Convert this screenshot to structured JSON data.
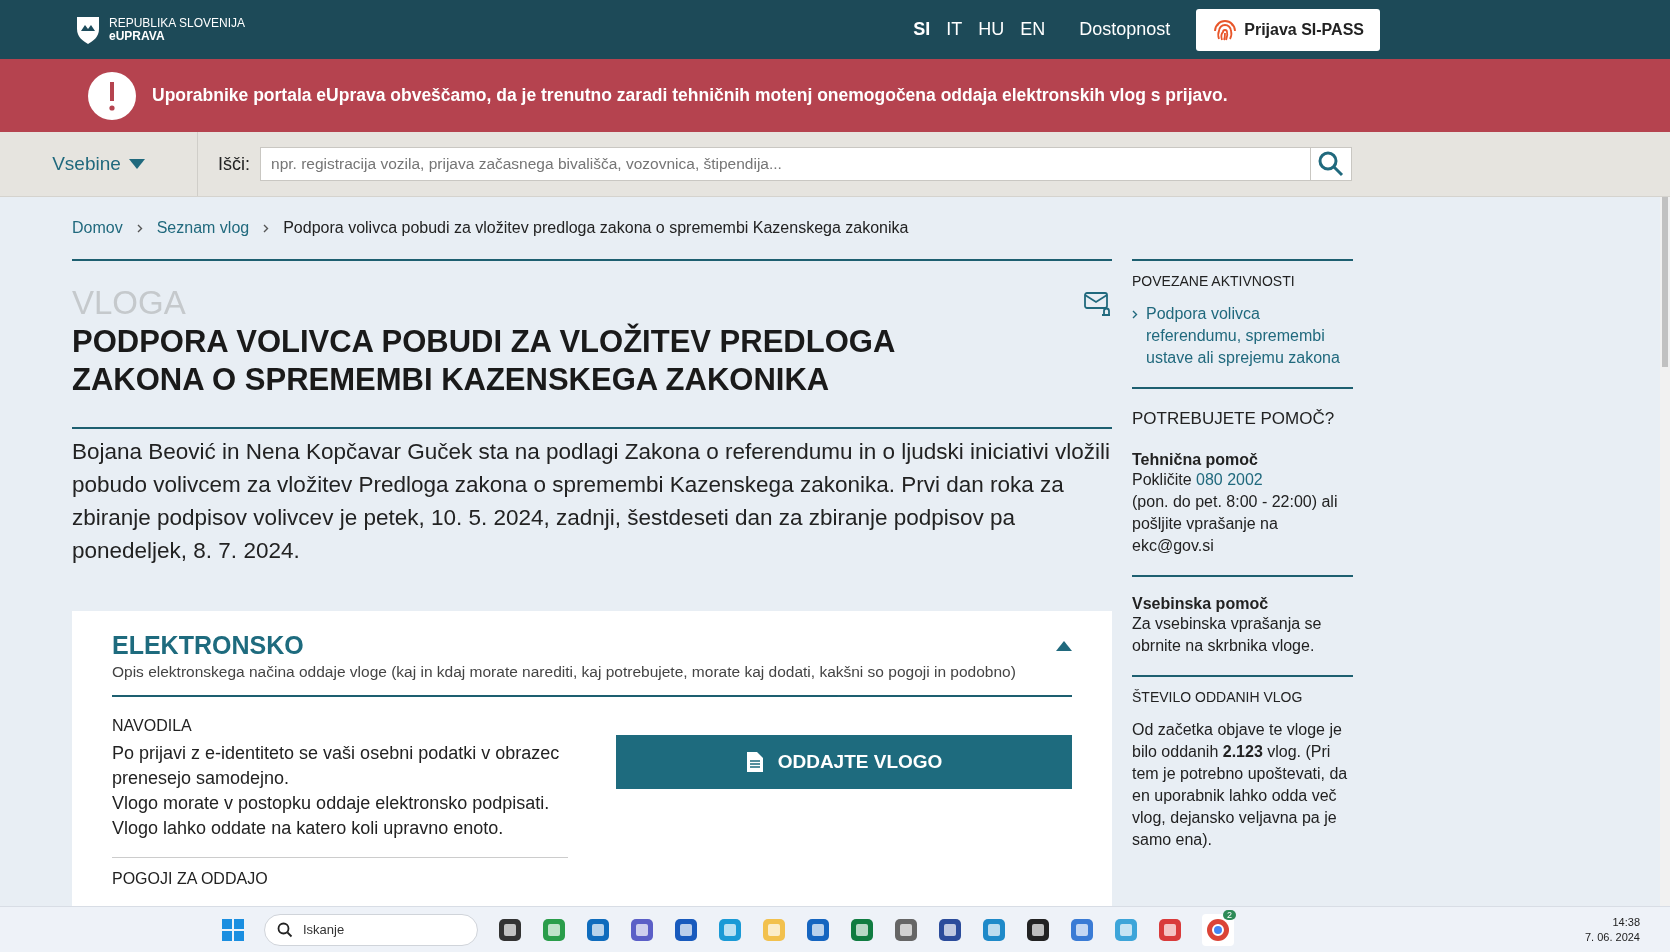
{
  "header": {
    "logo_line1": "REPUBLIKA SLOVENIJA",
    "logo_line2": "eUPRAVA",
    "languages": [
      {
        "label": "SI",
        "selected": true
      },
      {
        "label": "IT",
        "selected": false
      },
      {
        "label": "HU",
        "selected": false
      },
      {
        "label": "EN",
        "selected": false
      }
    ],
    "accessibility_link": "Dostopnost",
    "login_button": "Prijava SI-PASS"
  },
  "alert": {
    "text": "Uporabnike portala eUprava obveščamo, da je trenutno zaradi tehničnih motenj onemogočena oddaja elektronskih vlog s prijavo."
  },
  "search": {
    "menu_label": "Vsebine",
    "label": "Išči:",
    "placeholder": "npr. registracija vozila, prijava začasnega bivališča, vozovnica, štipendija..."
  },
  "breadcrumb": [
    {
      "label": "Domov",
      "kind": "link"
    },
    {
      "label": "Seznam vlog",
      "kind": "link"
    },
    {
      "label": "Podpora volivca pobudi za vložitev predloga zakona o spremembi Kazenskega zakonika",
      "kind": "current"
    }
  ],
  "main": {
    "overline": "VLOGA",
    "title": "PODPORA VOLIVCA POBUDI ZA VLOŽITEV PREDLOGA ZAKONA O SPREMEMBI KAZENSKEGA ZAKONIKA",
    "description": "Bojana Beović in Nena Kopčavar Guček sta na podlagi Zakona o referendumu in o ljudski iniciativi vložili pobudo volivcem za vložitev Predloga zakona o spremembi Kazenskega zakonika. Prvi dan roka za zbiranje podpisov volivcev je petek, 10. 5. 2024, zadnji, šestdeseti dan za zbiranje podpisov pa ponedeljek, 8. 7. 2024."
  },
  "section": {
    "title": "ELEKTRONSKO",
    "subtitle": "Opis elektronskega načina oddaje vloge (kaj in kdaj morate narediti, kaj potrebujete, morate kaj dodati, kakšni so pogoji in podobno)",
    "expanded": true,
    "instructions_heading": "NAVODILA",
    "instructions": [
      "Po prijavi z e-identiteto se vaši osebni podatki v obrazec prenesejo samodejno.",
      "Vlogo morate v postopku oddaje elektronsko podpisati.",
      "Vlogo lahko oddate na katero koli upravno enoto."
    ],
    "submit_button": "ODDAJTE VLOGO",
    "next_heading": "POGOJI ZA ODDAJO"
  },
  "sidebar": {
    "related": {
      "heading": "POVEZANE AKTIVNOSTI",
      "links": [
        "Podpora volivca referendumu, spremembi ustave ali sprejemu zakona"
      ]
    },
    "help": {
      "heading": "POTREBUJETE POMOČ?",
      "technical_title": "Tehnična pomoč",
      "call_prefix": "Pokličite",
      "phone": "080 2002",
      "technical_rest": "(pon. do pet. 8:00 - 22:00) ali pošljite vprašanje na ekc@gov.si",
      "content_title": "Vsebinska pomoč",
      "content_text": "Za vsebinska vprašanja se obrnite na skrbnika vloge."
    },
    "count": {
      "heading": "ŠTEVILO ODDANIH VLOG",
      "text": "Od začetka objave te vloge je bilo oddanih **2.123** vlog. (Pri tem je potrebno upoštevati, da en uporabnik lahko odda več vlog, dejansko veljavna pa je samo ena)."
    }
  },
  "taskbar": {
    "search_placeholder": "Iskanje",
    "badge": "2",
    "time": "14:38",
    "date": "7. 06. 2024"
  }
}
